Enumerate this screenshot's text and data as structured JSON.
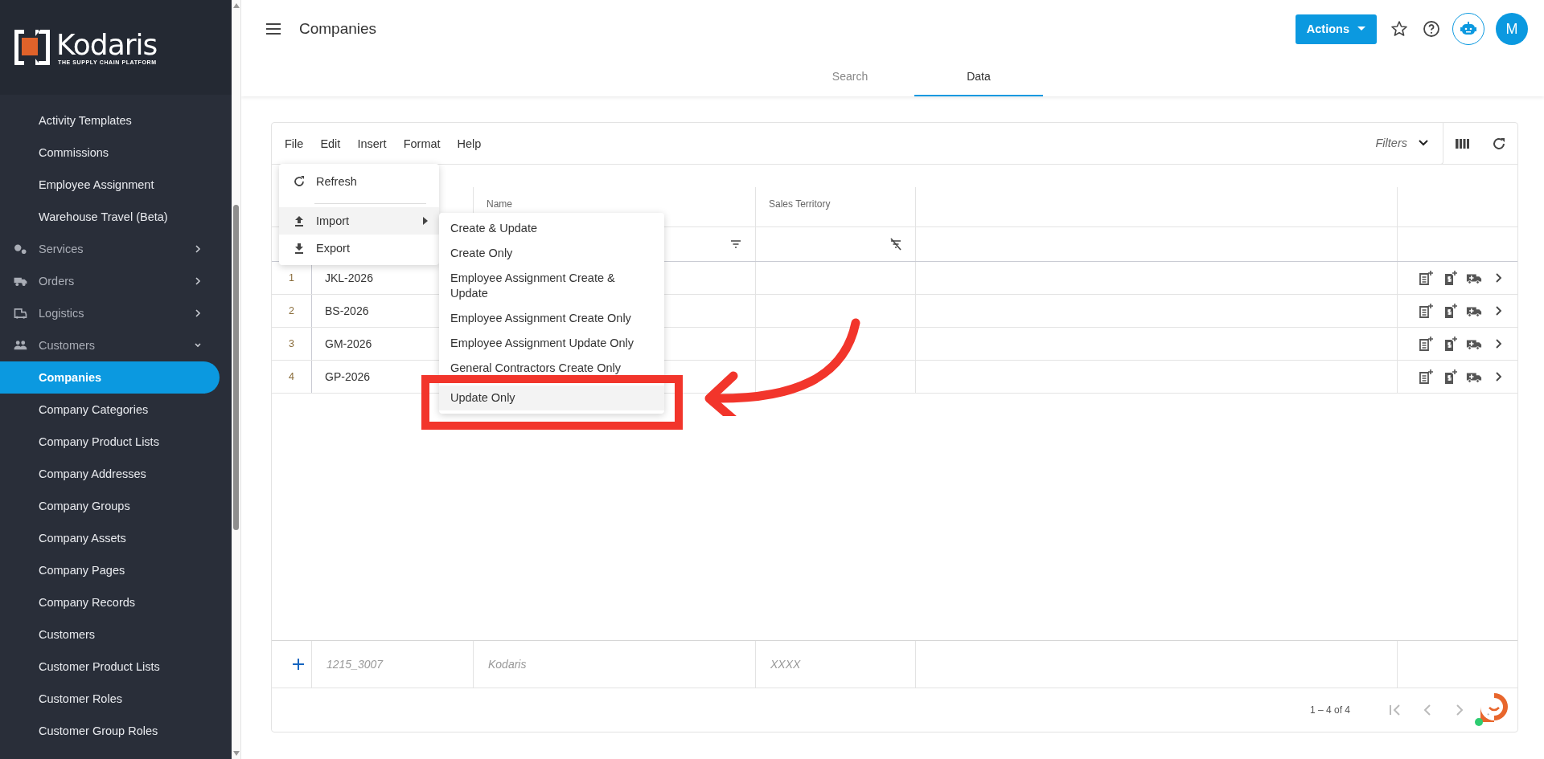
{
  "sidebar": {
    "logo": {
      "name": "Kodaris",
      "tagline": "THE SUPPLY CHAIN PLATFORM"
    },
    "items": [
      {
        "label": "Activity Templates",
        "kind": "link",
        "selected": false
      },
      {
        "label": "Commissions",
        "kind": "link",
        "selected": false
      },
      {
        "label": "Employee Assignment",
        "kind": "link",
        "selected": false
      },
      {
        "label": "Warehouse Travel (Beta)",
        "kind": "link",
        "selected": false
      },
      {
        "label": "Services",
        "kind": "group",
        "expanded": false,
        "selected": false
      },
      {
        "label": "Orders",
        "kind": "group",
        "expanded": false,
        "selected": false
      },
      {
        "label": "Logistics",
        "kind": "group",
        "expanded": false,
        "selected": false
      },
      {
        "label": "Customers",
        "kind": "group",
        "expanded": true,
        "selected": false
      },
      {
        "label": "Companies",
        "kind": "link",
        "selected": true
      },
      {
        "label": "Company Categories",
        "kind": "link",
        "selected": false
      },
      {
        "label": "Company Product Lists",
        "kind": "link",
        "selected": false
      },
      {
        "label": "Company Addresses",
        "kind": "link",
        "selected": false
      },
      {
        "label": "Company Groups",
        "kind": "link",
        "selected": false
      },
      {
        "label": "Company Assets",
        "kind": "link",
        "selected": false
      },
      {
        "label": "Company Pages",
        "kind": "link",
        "selected": false
      },
      {
        "label": "Company Records",
        "kind": "link",
        "selected": false
      },
      {
        "label": "Customers",
        "kind": "link",
        "selected": false
      },
      {
        "label": "Customer Product Lists",
        "kind": "link",
        "selected": false
      },
      {
        "label": "Customer Roles",
        "kind": "link",
        "selected": false
      },
      {
        "label": "Customer Group Roles",
        "kind": "link",
        "selected": false
      }
    ]
  },
  "header": {
    "title": "Companies",
    "actions_label": "Actions",
    "avatar": "M"
  },
  "tabs": [
    {
      "label": "Search",
      "selected": false
    },
    {
      "label": "Data",
      "selected": true
    }
  ],
  "toolbar": {
    "menus": [
      "File",
      "Edit",
      "Insert",
      "Format",
      "Help"
    ],
    "filters_label": "Filters"
  },
  "table": {
    "columns": [
      {
        "label": "Name",
        "filter_enabled": true
      },
      {
        "label": "Sales Territory",
        "filter_enabled": false
      }
    ],
    "rows": [
      {
        "number": "1",
        "code": "JKL-2026"
      },
      {
        "number": "2",
        "code": "BS-2026"
      },
      {
        "number": "3",
        "code": "GM-2026"
      },
      {
        "number": "4",
        "code": "GP-2026"
      }
    ],
    "new_row": {
      "placeholders": [
        "1215_3007",
        "Kodaris",
        "XXXX"
      ]
    },
    "pagination": "1 – 4 of 4"
  },
  "file_menu": {
    "items": [
      {
        "label": "Refresh",
        "kind": "action",
        "highlighted": false
      },
      {
        "kind": "divider"
      },
      {
        "label": "Import",
        "kind": "submenu",
        "highlighted": true
      },
      {
        "label": "Export",
        "kind": "action",
        "highlighted": false
      }
    ],
    "submenu": [
      {
        "label": "Create & Update",
        "highlighted": false
      },
      {
        "label": "Create Only",
        "highlighted": false
      },
      {
        "label": "Employee Assignment Create & Update",
        "highlighted": false
      },
      {
        "label": "Employee Assignment Create Only",
        "highlighted": false
      },
      {
        "label": "Employee Assignment Update Only",
        "highlighted": false
      },
      {
        "label": "General Contractors Create Only",
        "highlighted": false
      },
      {
        "label": "Update Only",
        "highlighted": true
      }
    ]
  },
  "annotation": {
    "frame": true,
    "arrow": true
  }
}
